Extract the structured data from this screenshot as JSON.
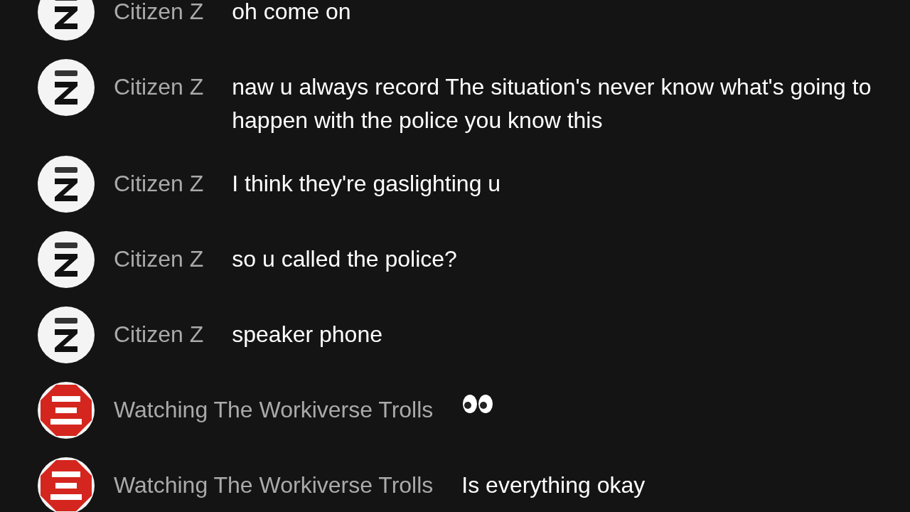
{
  "chat_messages": [
    {
      "author": "Citizen Z",
      "avatar": {
        "kind": "z-badge"
      },
      "kind": "text",
      "text": "oh come on"
    },
    {
      "author": "Citizen Z",
      "avatar": {
        "kind": "z-badge"
      },
      "kind": "text",
      "text": "naw u always record The situation's never know what's going to happen with the police you know this"
    },
    {
      "author": "Citizen Z",
      "avatar": {
        "kind": "z-badge"
      },
      "kind": "text",
      "text": "I think they're gaslighting u"
    },
    {
      "author": "Citizen Z",
      "avatar": {
        "kind": "z-badge"
      },
      "kind": "text",
      "text": "so u called the police?"
    },
    {
      "author": "Citizen Z",
      "avatar": {
        "kind": "z-badge"
      },
      "kind": "text",
      "text": "speaker phone"
    },
    {
      "author": "Watching The Workiverse Trolls",
      "avatar": {
        "kind": "stop-sign"
      },
      "kind": "emoji"
    },
    {
      "author": "Watching The Workiverse Trolls",
      "avatar": {
        "kind": "stop-sign"
      },
      "kind": "text",
      "text": "Is everything okay"
    }
  ]
}
